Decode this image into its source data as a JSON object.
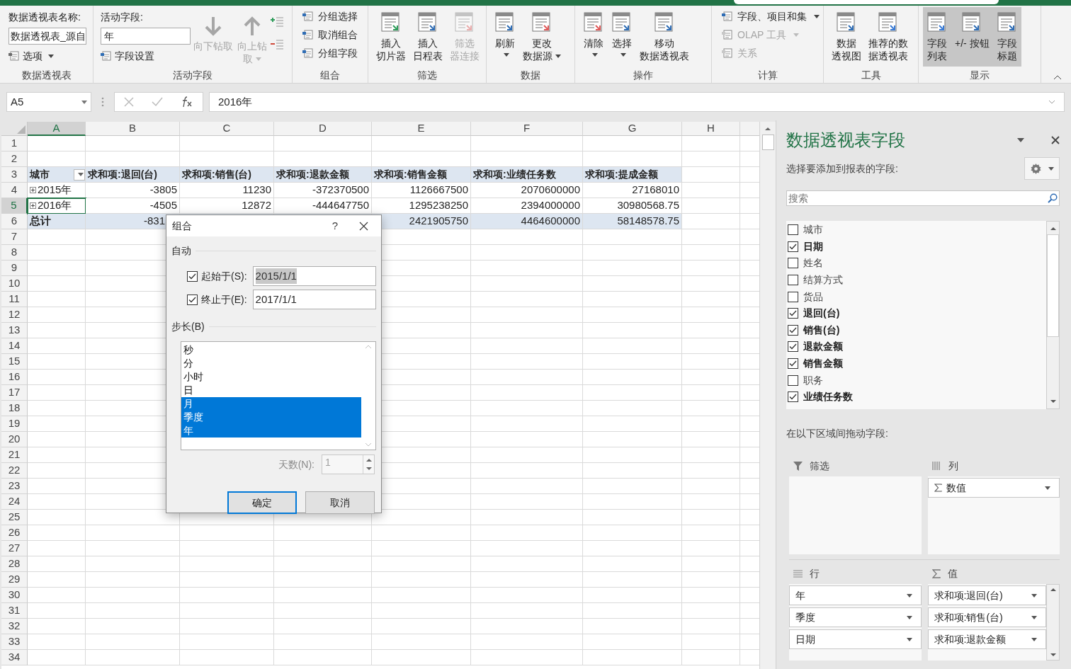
{
  "ribbon": {
    "groups": [
      {
        "kind": "pivot-name",
        "label": "数据透视表",
        "title": "数据透视表名称:",
        "value": "数据透视表_源自",
        "options": "选项"
      },
      {
        "kind": "active-field",
        "label": "活动字段",
        "title": "活动字段:",
        "value": "年",
        "settings": "字段设置",
        "items": [
          {
            "lines": [
              "向下钻取"
            ],
            "disabled": true,
            "dropdown": false
          },
          {
            "lines": [
              "向上钻",
              "取"
            ],
            "disabled": true,
            "dropdown": true
          }
        ]
      },
      {
        "kind": "small",
        "label": "组合",
        "items": [
          {
            "text": "分组选择",
            "disabled": false,
            "dropdown": false
          },
          {
            "text": "取消组合",
            "disabled": false,
            "dropdown": false
          },
          {
            "text": "分组字段",
            "disabled": false,
            "dropdown": false
          }
        ]
      },
      {
        "kind": "large",
        "label": "筛选",
        "items": [
          {
            "lines": [
              "插入",
              "切片器"
            ],
            "disabled": false,
            "dropdown": false,
            "on": false
          },
          {
            "lines": [
              "插入",
              "日程表"
            ],
            "disabled": false,
            "dropdown": false,
            "on": false
          },
          {
            "lines": [
              "筛选",
              "器连接"
            ],
            "disabled": true,
            "dropdown": false,
            "on": false
          }
        ]
      },
      {
        "kind": "large",
        "label": "数据",
        "items": [
          {
            "lines": [
              "刷新"
            ],
            "disabled": false,
            "dropdown": true,
            "on": false
          },
          {
            "lines": [
              "更改",
              "数据源"
            ],
            "disabled": false,
            "dropdown": true,
            "on": false
          }
        ]
      },
      {
        "kind": "large",
        "label": "操作",
        "items": [
          {
            "lines": [
              "清除"
            ],
            "disabled": false,
            "dropdown": true,
            "on": false
          },
          {
            "lines": [
              "选择"
            ],
            "disabled": false,
            "dropdown": true,
            "on": false
          },
          {
            "lines": [
              "移动",
              "数据透视表"
            ],
            "disabled": false,
            "dropdown": false,
            "on": false
          }
        ]
      },
      {
        "kind": "small",
        "label": "计算",
        "items": [
          {
            "text": "字段、项目和集",
            "disabled": false,
            "dropdown": true
          },
          {
            "text": "OLAP 工具",
            "disabled": true,
            "dropdown": true
          },
          {
            "text": "关系",
            "disabled": true,
            "dropdown": false
          }
        ]
      },
      {
        "kind": "large",
        "label": "工具",
        "items": [
          {
            "lines": [
              "数据",
              "透视图"
            ],
            "disabled": false,
            "dropdown": false,
            "on": false
          },
          {
            "lines": [
              "推荐的数",
              "据透视表"
            ],
            "disabled": false,
            "dropdown": false,
            "on": false
          }
        ]
      },
      {
        "kind": "large",
        "label": "显示",
        "items": [
          {
            "lines": [
              "字段",
              "列表"
            ],
            "disabled": false,
            "dropdown": false,
            "on": true
          },
          {
            "lines": [
              "+/- 按钮"
            ],
            "disabled": false,
            "dropdown": false,
            "on": true
          },
          {
            "lines": [
              "字段",
              "标题"
            ],
            "disabled": false,
            "dropdown": false,
            "on": true
          }
        ]
      }
    ]
  },
  "formula_bar": {
    "name_box": "A5",
    "formula": "2016年"
  },
  "sheet": {
    "columns": [
      {
        "label": "A",
        "selected": true
      },
      {
        "label": "B",
        "selected": false
      },
      {
        "label": "C",
        "selected": false
      },
      {
        "label": "D",
        "selected": false
      },
      {
        "label": "E",
        "selected": false
      },
      {
        "label": "F",
        "selected": false
      },
      {
        "label": "G",
        "selected": false
      },
      {
        "label": "H",
        "selected": false
      }
    ],
    "rows": [
      {
        "label": "1",
        "selected": false
      },
      {
        "label": "2",
        "selected": false
      },
      {
        "label": "3",
        "selected": false,
        "kind": "header",
        "cells": [
          {
            "text": "城市",
            "filter": true
          },
          {
            "text": "求和项:退回(台)",
            "filter": false
          },
          {
            "text": "求和项:销售(台)",
            "filter": false
          },
          {
            "text": "求和项:退款金额",
            "filter": false
          },
          {
            "text": "求和项:销售金额",
            "filter": false
          },
          {
            "text": "求和项:业绩任务数",
            "filter": false
          },
          {
            "text": "求和项:提成金额",
            "filter": false
          }
        ]
      },
      {
        "label": "4",
        "selected": false,
        "kind": "item",
        "cells": [
          {
            "text": "2015年",
            "expandable": true,
            "selected": false
          },
          {
            "text": "-3805"
          },
          {
            "text": "11230"
          },
          {
            "text": "-372370500"
          },
          {
            "text": "1126667500"
          },
          {
            "text": "2070600000"
          },
          {
            "text": "27168010"
          }
        ]
      },
      {
        "label": "5",
        "selected": true,
        "kind": "item",
        "cells": [
          {
            "text": "2016年",
            "expandable": true,
            "selected": true
          },
          {
            "text": "-4505"
          },
          {
            "text": "12872"
          },
          {
            "text": "-444647750"
          },
          {
            "text": "1295238250"
          },
          {
            "text": "2394000000"
          },
          {
            "text": "30980568.75"
          }
        ]
      },
      {
        "label": "6",
        "selected": false,
        "kind": "total",
        "cells": [
          {
            "text": "总计"
          },
          {
            "text": "-831"
          },
          null,
          null,
          {
            "text": "2421905750"
          },
          {
            "text": "4464600000"
          },
          {
            "text": "58148578.75"
          }
        ]
      },
      {
        "label": "7",
        "selected": false
      },
      {
        "label": "8",
        "selected": false
      },
      {
        "label": "9",
        "selected": false
      },
      {
        "label": "10",
        "selected": false
      },
      {
        "label": "11",
        "selected": false
      },
      {
        "label": "12",
        "selected": false
      },
      {
        "label": "13",
        "selected": false
      },
      {
        "label": "14",
        "selected": false
      },
      {
        "label": "15",
        "selected": false
      },
      {
        "label": "16",
        "selected": false
      },
      {
        "label": "17",
        "selected": false
      },
      {
        "label": "18",
        "selected": false
      },
      {
        "label": "19",
        "selected": false
      },
      {
        "label": "20",
        "selected": false
      },
      {
        "label": "21",
        "selected": false
      },
      {
        "label": "22",
        "selected": false
      },
      {
        "label": "23",
        "selected": false
      },
      {
        "label": "24",
        "selected": false
      },
      {
        "label": "25",
        "selected": false
      },
      {
        "label": "26",
        "selected": false
      },
      {
        "label": "27",
        "selected": false
      },
      {
        "label": "28",
        "selected": false
      },
      {
        "label": "29",
        "selected": false
      },
      {
        "label": "30",
        "selected": false
      },
      {
        "label": "31",
        "selected": false
      },
      {
        "label": "32",
        "selected": false
      },
      {
        "label": "33",
        "selected": false
      },
      {
        "label": "34",
        "selected": false
      }
    ]
  },
  "dialog": {
    "title": "组合",
    "help": "?",
    "section_auto": "自动",
    "start": {
      "label": "起始于(S):",
      "checked": true,
      "value": "2015/1/1",
      "highlighted": true
    },
    "end": {
      "label": "终止于(E):",
      "checked": true,
      "value": "2017/1/1",
      "highlighted": false
    },
    "section_step": "步长(B)",
    "steps": [
      {
        "text": "秒",
        "selected": false
      },
      {
        "text": "分",
        "selected": false
      },
      {
        "text": "小时",
        "selected": false
      },
      {
        "text": "日",
        "selected": false
      },
      {
        "text": "月",
        "selected": true
      },
      {
        "text": "季度",
        "selected": true
      },
      {
        "text": "年",
        "selected": true
      }
    ],
    "days": {
      "label": "天数(N):",
      "value": "1",
      "disabled": true
    },
    "buttons": [
      {
        "text": "确定",
        "default": true
      },
      {
        "text": "取消",
        "default": false
      }
    ]
  },
  "field_pane": {
    "title": "数据透视表字段",
    "subtitle": "选择要添加到报表的字段:",
    "search_placeholder": "搜索",
    "fields": [
      {
        "text": "城市",
        "checked": false
      },
      {
        "text": "日期",
        "checked": true
      },
      {
        "text": "姓名",
        "checked": false
      },
      {
        "text": "结算方式",
        "checked": false
      },
      {
        "text": "货品",
        "checked": false
      },
      {
        "text": "退回(台)",
        "checked": true
      },
      {
        "text": "销售(台)",
        "checked": true
      },
      {
        "text": "退款金额",
        "checked": true
      },
      {
        "text": "销售金额",
        "checked": true
      },
      {
        "text": "职务",
        "checked": false
      },
      {
        "text": "业绩任务数",
        "checked": true
      }
    ],
    "areas_hint": "在以下区域间拖动字段:",
    "areas": [
      {
        "kind": "filter",
        "label": "筛选"
      },
      {
        "kind": "columns",
        "label": "列",
        "items": [
          {
            "text": "数值",
            "sigma": true
          }
        ]
      },
      {
        "kind": "rows",
        "label": "行",
        "items": [
          {
            "text": "年",
            "sigma": false
          },
          {
            "text": "季度",
            "sigma": false
          },
          {
            "text": "日期",
            "sigma": false
          }
        ]
      },
      {
        "kind": "values",
        "label": "值",
        "items": [
          {
            "text": "求和项:退回(台)",
            "sigma": false
          },
          {
            "text": "求和项:销售(台)",
            "sigma": false
          },
          {
            "text": "求和项:退款金额",
            "sigma": false
          }
        ]
      }
    ]
  }
}
